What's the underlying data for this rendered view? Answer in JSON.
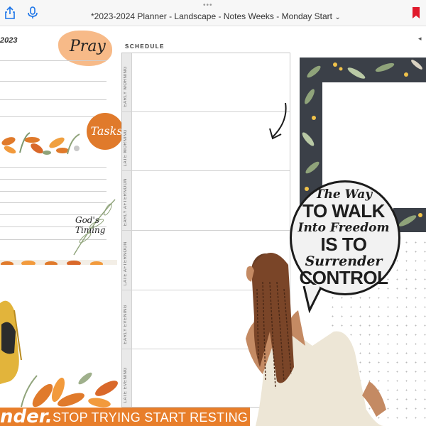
{
  "toolbar": {
    "more_dots": "•••",
    "title": "*2023-2024 Planner - Landscape - Notes Weeks - Monday Start",
    "title_chevron": "⌄",
    "icons": [
      "share-icon",
      "microphone-icon",
      "bookmark-icon"
    ],
    "accent_color": "#1a73e8",
    "bookmark_color": "#e0192b"
  },
  "left_panel": {
    "year": "2023",
    "pray_label": "Pray",
    "tasks_label": "Tasks",
    "gods_timing": "God's Timing"
  },
  "schedule": {
    "title": "SCHEDULE",
    "rows": [
      "EARLY MORNING",
      "LATE MORNING",
      "EARLY AFTERNOON",
      "LATE AFTERNOON",
      "EARLY EVENING",
      "LATE EVENING"
    ]
  },
  "quote": {
    "line1": "The Way",
    "line2": "TO WALK",
    "line3": "Into Freedom",
    "line4": "IS TO",
    "line5": "Surrender",
    "line6": "CONTROL"
  },
  "banner": {
    "word": "nder.",
    "text": "STOP TRYING START RESTING"
  },
  "colors": {
    "orange": "#e87e2a",
    "dark_slate": "#3b4048",
    "leaf_green": "#8fa37a",
    "peach": "#f6b37b"
  }
}
